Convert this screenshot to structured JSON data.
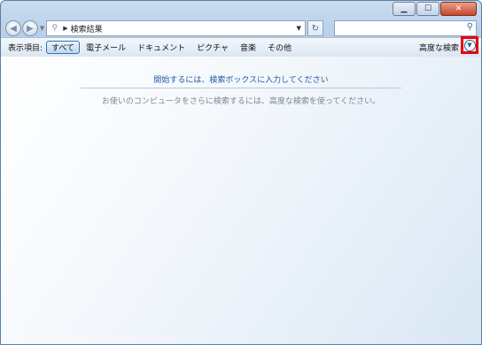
{
  "window": {
    "minimize_icon": "minimize-icon",
    "maximize_icon": "maximize-icon",
    "close_icon": "close-icon"
  },
  "nav": {
    "back_icon": "back-arrow-icon",
    "forward_icon": "forward-arrow-icon"
  },
  "address": {
    "path": "検索結果"
  },
  "search": {
    "value": "",
    "placeholder": ""
  },
  "toolbar": {
    "show_label": "表示項目:",
    "filters": [
      {
        "label": "すべて",
        "active": true
      },
      {
        "label": "電子メール"
      },
      {
        "label": "ドキュメント"
      },
      {
        "label": "ピクチャ"
      },
      {
        "label": "音楽"
      },
      {
        "label": "その他"
      }
    ],
    "advanced_label": "高度な検索"
  },
  "content": {
    "start_message": "開始するには、検索ボックスに入力してください",
    "advanced_message": "お使いのコンピュータをさらに検索するには、高度な検索を使ってください。"
  },
  "colors": {
    "highlight": "#e8000e",
    "link": "#2157a8"
  }
}
